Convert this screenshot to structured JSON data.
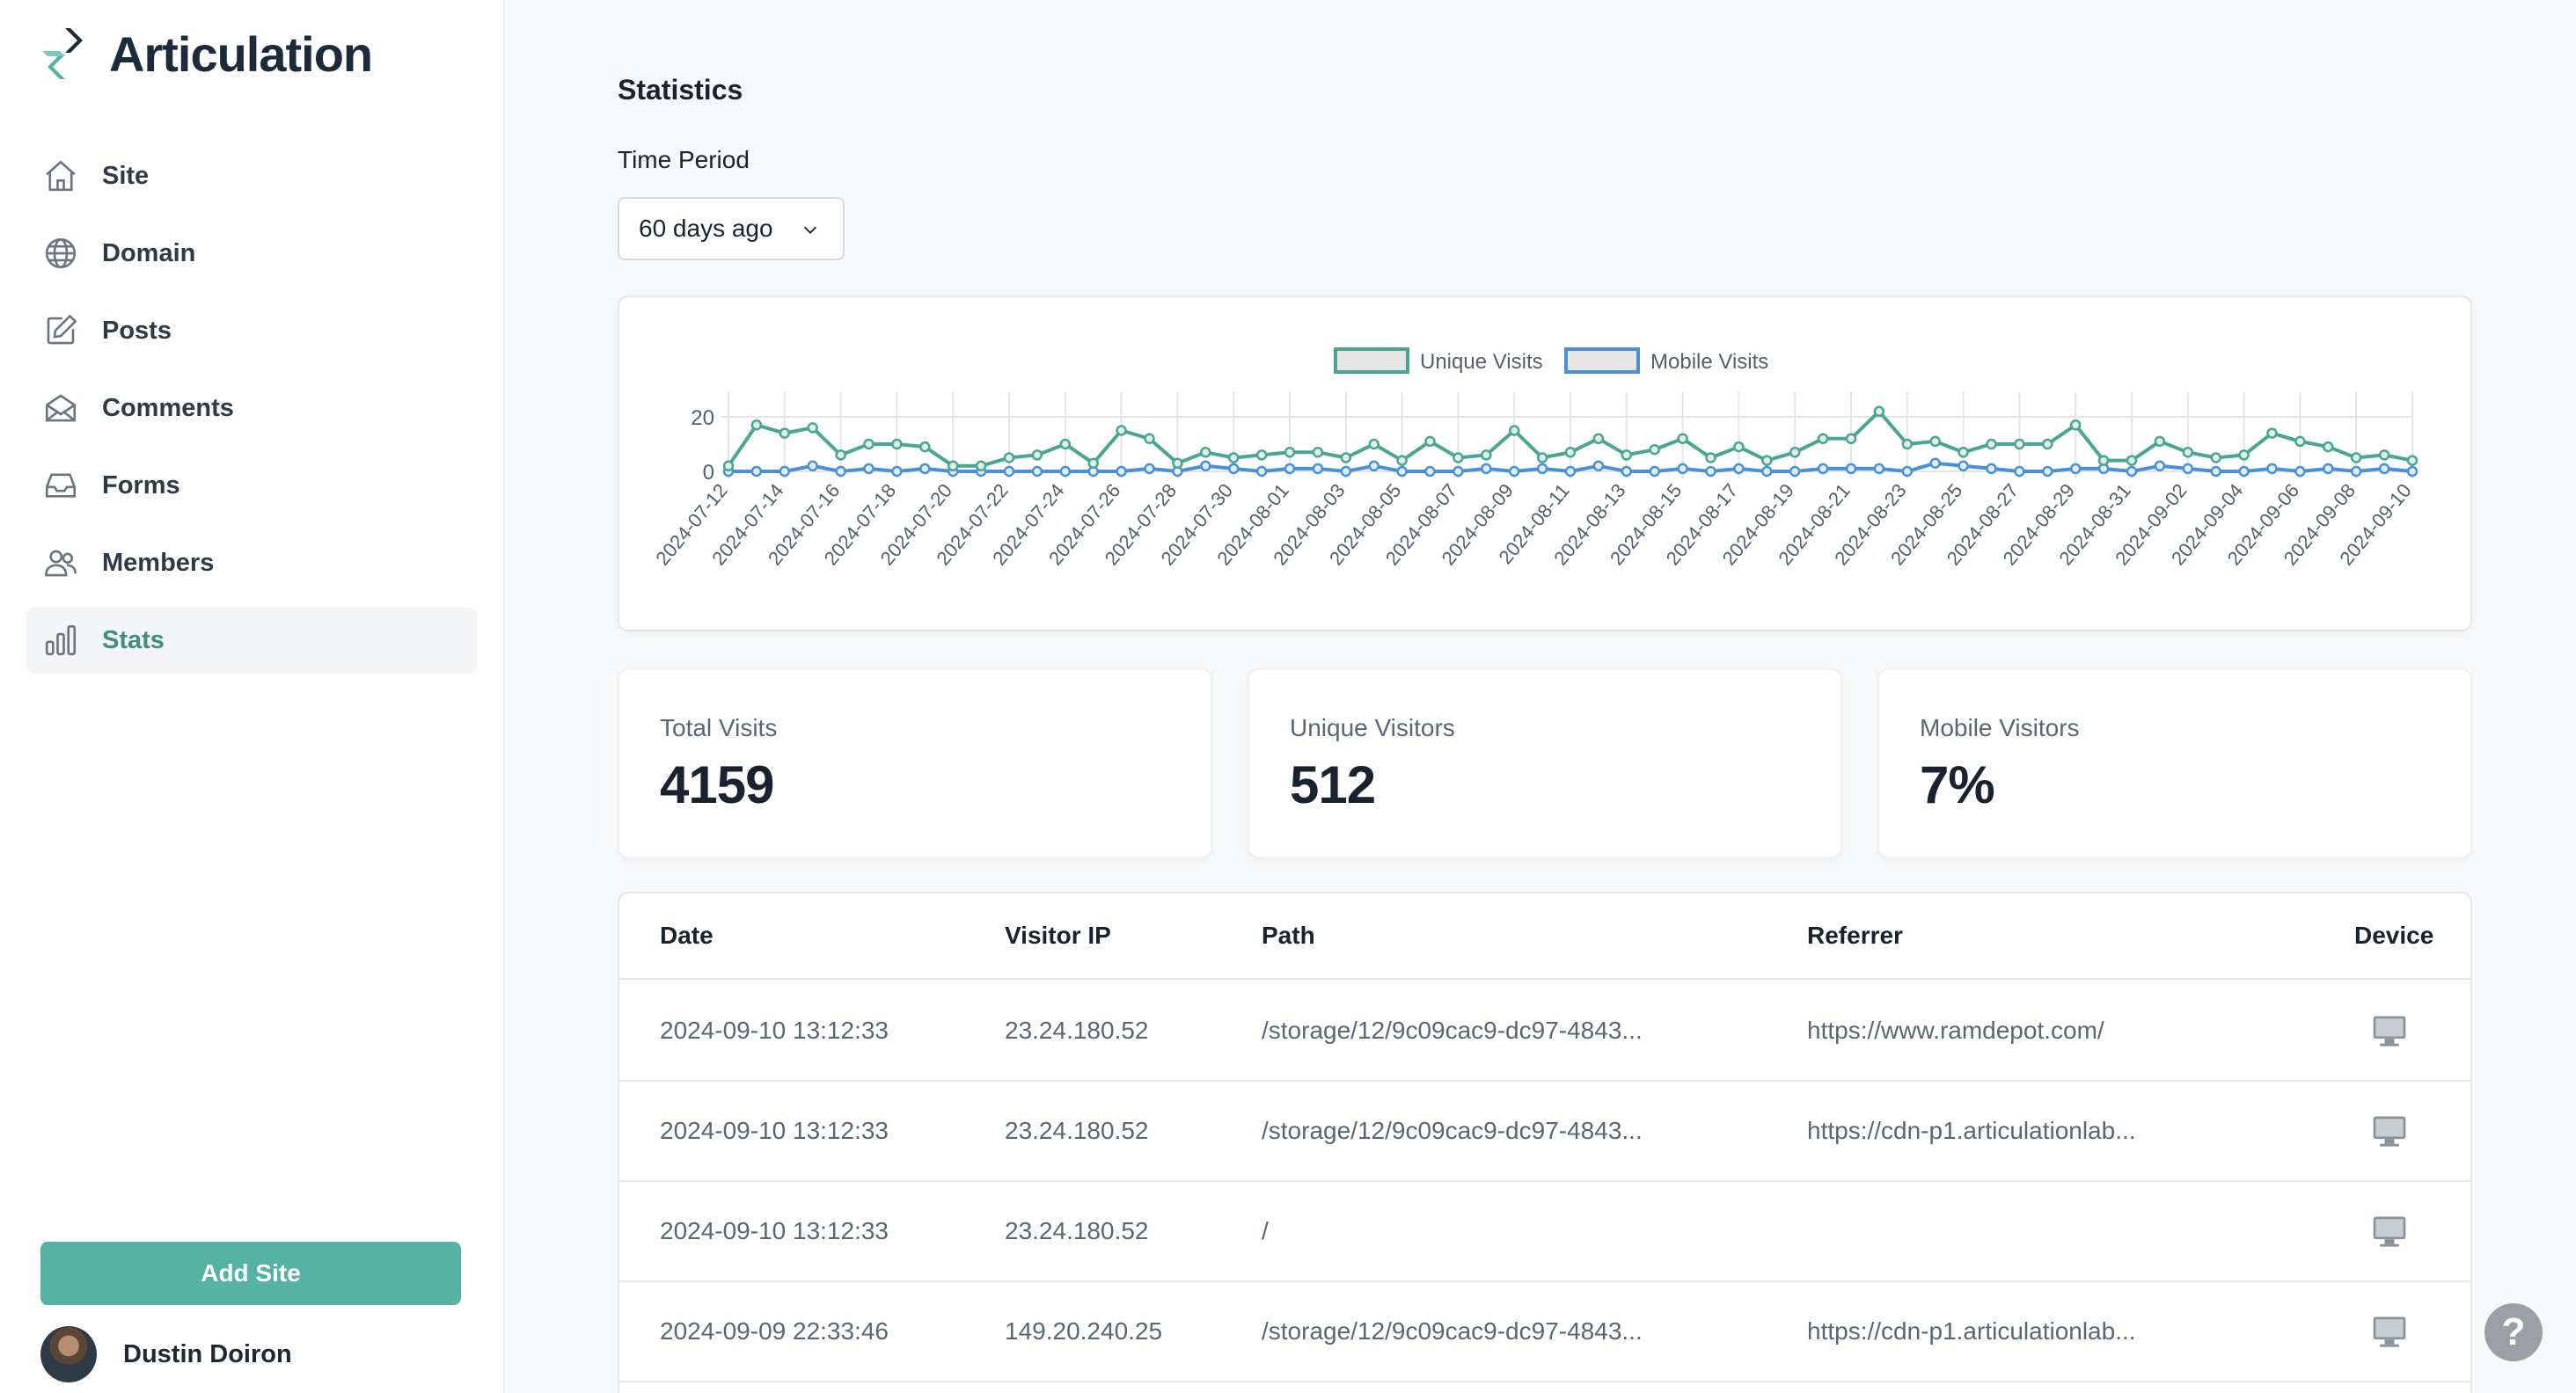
{
  "app": {
    "name": "Articulation"
  },
  "sidebar": {
    "items": [
      {
        "label": "Site",
        "icon": "home-icon"
      },
      {
        "label": "Domain",
        "icon": "globe-icon"
      },
      {
        "label": "Posts",
        "icon": "edit-icon"
      },
      {
        "label": "Comments",
        "icon": "mail-open-icon"
      },
      {
        "label": "Forms",
        "icon": "inbox-icon"
      },
      {
        "label": "Members",
        "icon": "users-icon"
      },
      {
        "label": "Stats",
        "icon": "bar-chart-icon",
        "active": true
      }
    ],
    "add_site_label": "Add Site",
    "user_name": "Dustin Doiron"
  },
  "main": {
    "title": "Statistics",
    "period_label": "Time Period",
    "period_value": "60 days ago"
  },
  "chart_data": {
    "type": "line",
    "legend_position": "top-center",
    "grid": true,
    "ylim": [
      0,
      20
    ],
    "yticks": [
      0,
      20
    ],
    "x_start": "2024-07-12",
    "x_end": "2024-09-10",
    "tick_labels": [
      "2024-07-12",
      "2024-07-14",
      "2024-07-16",
      "2024-07-18",
      "2024-07-20",
      "2024-07-22",
      "2024-07-24",
      "2024-07-26",
      "2024-07-28",
      "2024-07-30",
      "2024-08-01",
      "2024-08-03",
      "2024-08-05",
      "2024-08-07",
      "2024-08-09",
      "2024-08-11",
      "2024-08-13",
      "2024-08-15",
      "2024-08-17",
      "2024-08-19",
      "2024-08-21",
      "2024-08-23",
      "2024-08-25",
      "2024-08-27",
      "2024-08-29",
      "2024-08-31",
      "2024-09-02",
      "2024-09-04",
      "2024-09-06",
      "2024-09-08",
      "2024-09-10"
    ],
    "series": [
      {
        "name": "Unique Visits",
        "color": "#4aa592",
        "values": [
          2,
          17,
          14,
          16,
          6,
          10,
          10,
          9,
          2,
          2,
          5,
          6,
          10,
          3,
          15,
          12,
          3,
          7,
          5,
          6,
          7,
          7,
          5,
          10,
          4,
          11,
          5,
          6,
          15,
          5,
          7,
          12,
          6,
          8,
          12,
          5,
          9,
          4,
          7,
          12,
          12,
          22,
          10,
          11,
          7,
          10,
          10,
          10,
          17,
          4,
          4,
          11,
          7,
          5,
          6,
          14,
          11,
          9,
          5,
          6,
          4
        ]
      },
      {
        "name": "Mobile Visits",
        "color": "#4a90d9",
        "values": [
          0,
          0,
          0,
          2,
          0,
          1,
          0,
          1,
          0,
          0,
          0,
          0,
          0,
          0,
          0,
          1,
          0,
          2,
          1,
          0,
          1,
          1,
          0,
          2,
          0,
          0,
          0,
          1,
          0,
          1,
          0,
          2,
          0,
          0,
          1,
          0,
          1,
          0,
          0,
          1,
          1,
          1,
          0,
          3,
          2,
          1,
          0,
          0,
          1,
          1,
          0,
          2,
          1,
          0,
          0,
          1,
          0,
          1,
          0,
          1,
          0
        ]
      }
    ]
  },
  "stats": [
    {
      "label": "Total Visits",
      "value": "4159"
    },
    {
      "label": "Unique Visitors",
      "value": "512"
    },
    {
      "label": "Mobile Visitors",
      "value": "7%"
    }
  ],
  "table": {
    "columns": [
      "Date",
      "Visitor IP",
      "Path",
      "Referrer",
      "Device"
    ],
    "rows": [
      {
        "date": "2024-09-10 13:12:33",
        "ip": "23.24.180.52",
        "path": "/storage/12/9c09cac9-dc97-4843...",
        "referrer": "https://www.ramdepot.com/",
        "device": "desktop-icon"
      },
      {
        "date": "2024-09-10 13:12:33",
        "ip": "23.24.180.52",
        "path": "/storage/12/9c09cac9-dc97-4843...",
        "referrer": "https://cdn-p1.articulationlab...",
        "device": "desktop-icon"
      },
      {
        "date": "2024-09-10 13:12:33",
        "ip": "23.24.180.52",
        "path": "/",
        "referrer": "",
        "device": "desktop-icon"
      },
      {
        "date": "2024-09-09 22:33:46",
        "ip": "149.20.240.25",
        "path": "/storage/12/9c09cac9-dc97-4843...",
        "referrer": "https://cdn-p1.articulationlab...",
        "device": "desktop-icon"
      }
    ]
  },
  "help_label": "?"
}
